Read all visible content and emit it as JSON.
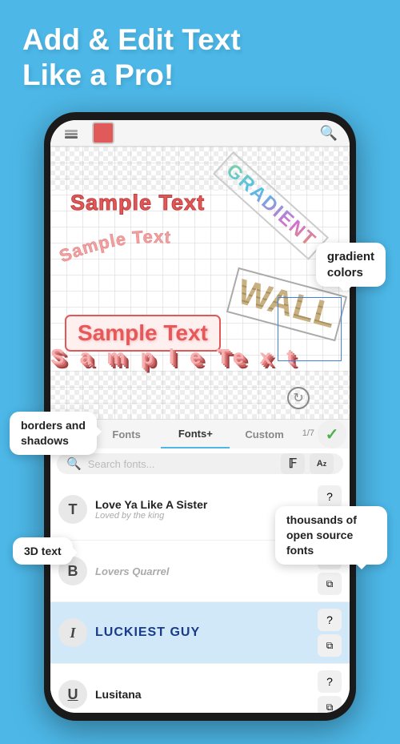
{
  "header": {
    "line1": "Add & Edit Text",
    "line2": "Like a Pro!"
  },
  "tooltips": {
    "gradient": "gradient\ncolors",
    "borders": "borders and\nshadows",
    "fonts": "thousands of\nopen source fonts",
    "text3d": "3D text",
    "custom": "Custom"
  },
  "canvas": {
    "sample_text_1": "Sample Text",
    "sample_text_2": "Sample Text",
    "sample_text_3": "Sample Text",
    "sample_text_3d": "S a m p l e  Te x t",
    "gradient_word": "GRADIENT",
    "wall_word": "WALL"
  },
  "tabs": {
    "fonts": "Fonts",
    "fonts_plus": "Fonts+",
    "custom": "Custom",
    "page_indicator": "1/7"
  },
  "font_list": [
    {
      "icon": "T",
      "name": "Love Ya Like A Sister",
      "sub": "Loved by the king",
      "highlighted": false
    },
    {
      "icon": "B",
      "name": "Lovers Quarrel",
      "sub": "",
      "highlighted": false
    },
    {
      "icon": "I",
      "name": "LUCKIEST GUY",
      "sub": "",
      "highlighted": true,
      "bold": true
    },
    {
      "icon": "U",
      "name": "Lusitana",
      "sub": "",
      "highlighted": false
    }
  ],
  "search": {
    "placeholder": "Search fonts..."
  },
  "icons": {
    "layers": "⊞",
    "search": "🔍",
    "menu": "≡",
    "back_arrow": "←",
    "checkmark": "✓",
    "rotate": "↻",
    "font_f": "𝔽",
    "font_a": "A",
    "question": "?",
    "copy": "⧉"
  }
}
